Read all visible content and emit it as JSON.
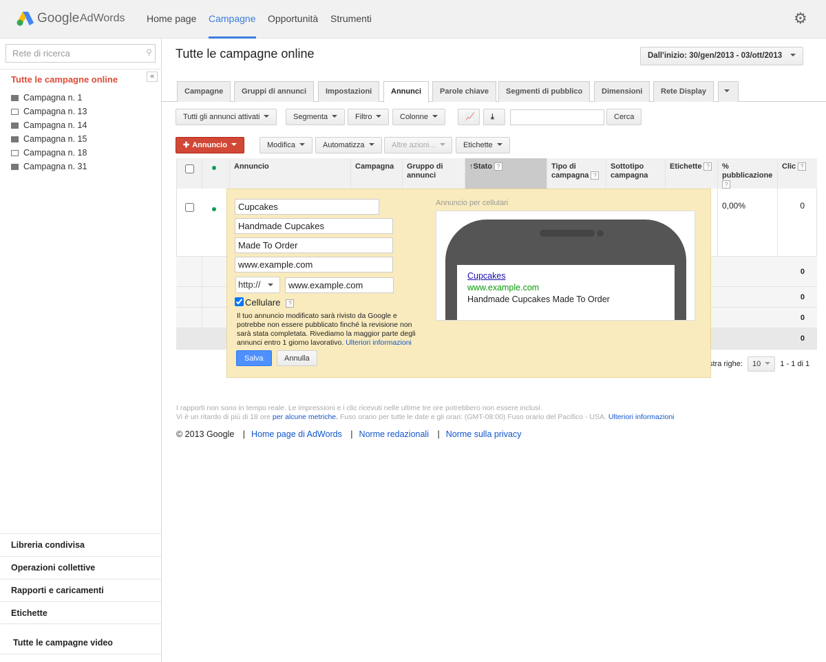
{
  "header": {
    "logo_google": "Google",
    "logo_adwords": "AdWords",
    "nav": [
      "Home page",
      "Campagne",
      "Opportunità",
      "Strumenti"
    ],
    "selected_nav": "Campagne",
    "settings_icon": "gear-icon",
    "brand_colors": {
      "blue": "#4285f4",
      "green": "#34a853",
      "yellow": "#fbbc05"
    }
  },
  "sidebar": {
    "search_placeholder": "Rete di ricerca",
    "title": "Tutte le campagne online",
    "campaigns": [
      {
        "label": "Campagna n. 1",
        "icon": "folder-icon"
      },
      {
        "label": "Campagna n. 13",
        "icon": "folder-paused-icon"
      },
      {
        "label": "Campagna n. 14",
        "icon": "folder-icon"
      },
      {
        "label": "Campagna n. 15",
        "icon": "folder-icon"
      },
      {
        "label": "Campagna n. 18",
        "icon": "folder-paused-icon"
      },
      {
        "label": "Campagna n. 31",
        "icon": "folder-icon"
      }
    ],
    "bottom": [
      "Libreria condivisa",
      "Operazioni collettive",
      "Rapporti e caricamenti",
      "Etichette"
    ],
    "video": "Tutte le campagne video",
    "collapse": "«"
  },
  "main": {
    "title": "Tutte le campagne online",
    "date_range": "Dall'inizio: 30/gen/2013 - 03/ott/2013",
    "tabs": [
      "Campagne",
      "Gruppi di annunci",
      "Impostazioni",
      "Annunci",
      "Parole chiave",
      "Segmenti di pubblico",
      "Dimensioni",
      "Rete Display"
    ],
    "selected_tab": "Annunci",
    "toolbar1": {
      "filter": "Tutti gli annunci attivati",
      "segment": "Segmenta",
      "filtro": "Filtro",
      "columns": "Colonne",
      "search_value": "",
      "search_button": "Cerca"
    },
    "toolbar2": {
      "new_ad": "Annuncio",
      "edit": "Modifica",
      "automate": "Automatizza",
      "more": "Altre azioni...",
      "labels": "Etichette"
    },
    "table": {
      "columns": [
        "Annuncio",
        "Campagna",
        "Gruppo di annunci",
        "Stato",
        "Tipo di campagna",
        "Sottotipo campagna",
        "Etichette",
        "% pubblicazione",
        "Clic"
      ],
      "row": {
        "publication": "0,00%",
        "clicks": "0"
      },
      "extra_rows": [
        "0",
        "0",
        "0"
      ],
      "total": "0"
    },
    "pagination": {
      "label": "stra righe:",
      "rows": "10",
      "range": "1 - 1 di 1"
    }
  },
  "editor": {
    "headline": "Cupcakes",
    "line1": "Handmade Cupcakes",
    "line2": "Made To Order",
    "display_url": "www.example.com",
    "protocol": "http://",
    "final_url": "www.example.com",
    "mobile_label": "Cellulare",
    "mobile_checked": true,
    "notice": "Il tuo annuncio modificato sarà rivisto da Google e potrebbe non essere pubblicato finché la revisione non sarà stata completata. Rivediamo la maggior parte degli annunci entro 1 giorno lavorativo.",
    "more_info": "Ulteriori informazioni",
    "save": "Salva",
    "cancel": "Annulla",
    "preview_label": "Annuncio per cellulari",
    "preview": {
      "headline": "Cupcakes",
      "url": "www.example.com",
      "desc": "Handmade Cupcakes Made To Order"
    }
  },
  "footer": {
    "note1": "I rapporti non sono in tempo reale. Le impressioni e i clic ricevuti nelle ultime tre ore potrebbero non essere inclusi.",
    "note2a": "Vi è un ritardo di più di 18 ore",
    "note2link": "per alcune metriche.",
    "note2b": "Fuso orario per tutte le date e gli orari: (GMT-08:00) Fuso orario del Pacifico - USA.",
    "note2link2": "Ulteriori informazioni",
    "copyright": "© 2013 Google",
    "links": [
      "Home page di AdWords",
      "Norme redazionali",
      "Norme sulla privacy"
    ]
  }
}
